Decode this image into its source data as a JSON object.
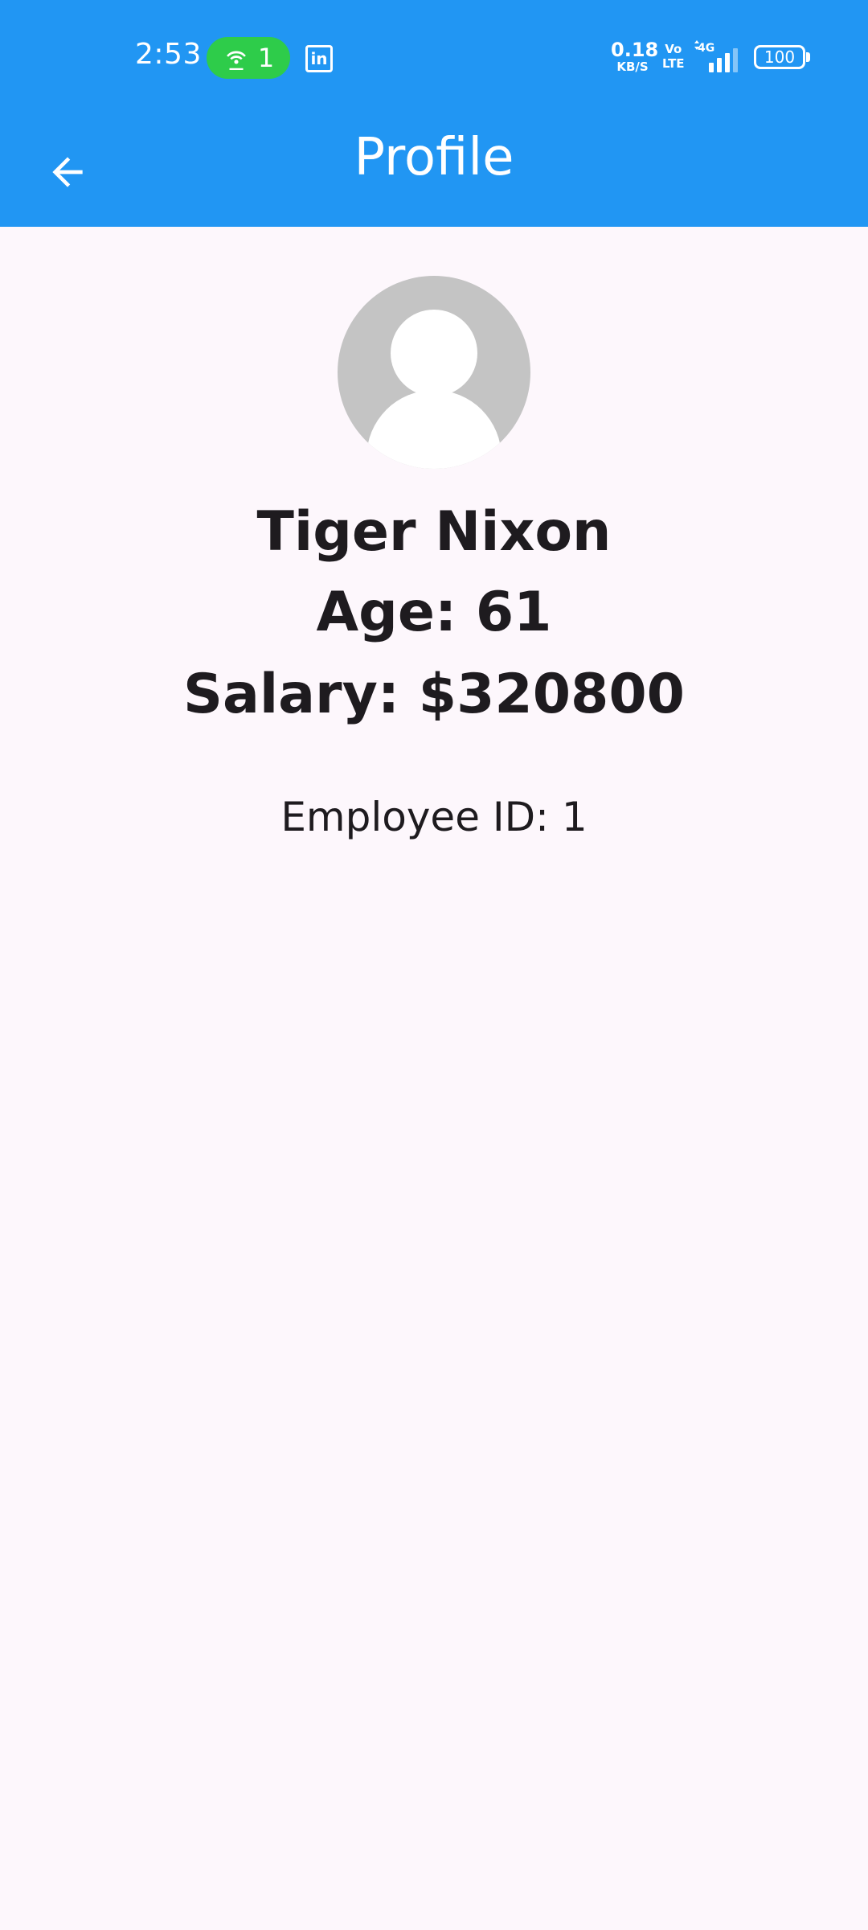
{
  "status_bar": {
    "time": "2:53",
    "hotspot_count": "1",
    "net_speed_value": "0.18",
    "net_speed_unit": "KB/S",
    "volte_top": "Vo",
    "volte_bottom": "LTE",
    "network_type": "4G",
    "battery_level": "100",
    "icons": [
      "hotspot-icon",
      "linkedin-icon",
      "signal-icon",
      "battery-icon"
    ]
  },
  "app_bar": {
    "title": "Profile",
    "back_icon": "arrow-left-icon",
    "background_color": "#2196f3"
  },
  "profile": {
    "avatar_icon": "person-placeholder-icon",
    "name": "Tiger Nixon",
    "age": "Age: 61",
    "salary": "Salary: $320800",
    "employee_id": "Employee ID: 1"
  }
}
